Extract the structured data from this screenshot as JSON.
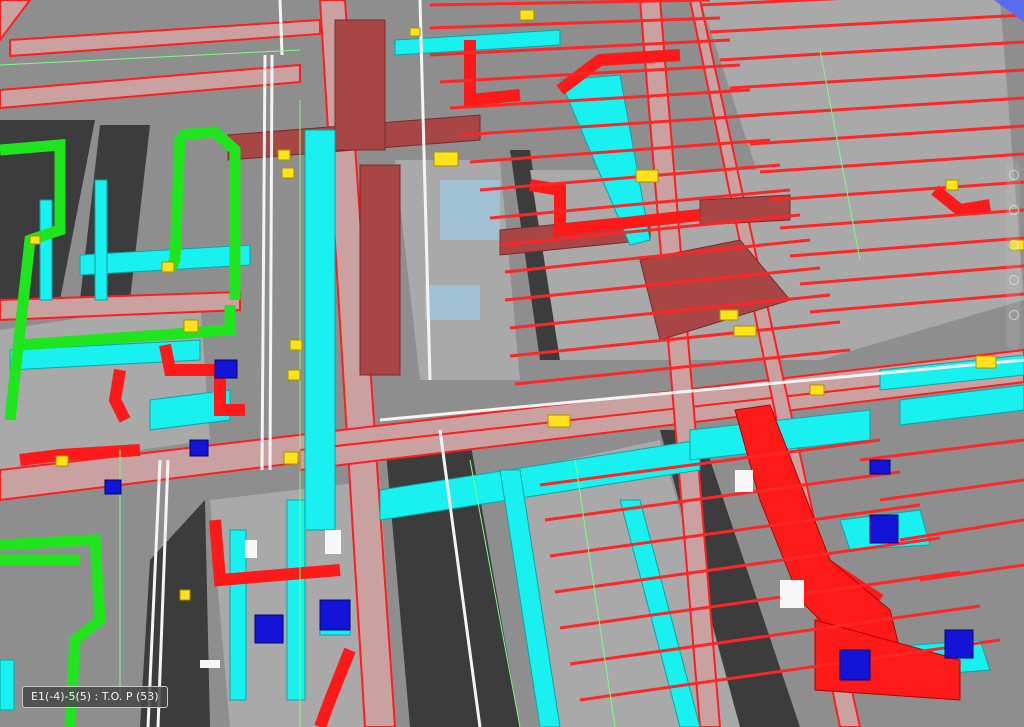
{
  "viewport": {
    "level_label": "E1(-4)-5(5) : T.O. P (53)"
  },
  "colors": {
    "background": "#5a5a5a",
    "slab": "#9a9a9a",
    "slab_shadow": "#3b3b3b",
    "beam_fill": "#c9a3a3",
    "beam_edge": "#ff1e1e",
    "hot_pipe": "#ff1a1a",
    "cold_duct": "#19f0f0",
    "green_pipe": "#1ee51e",
    "fitting_yellow": "#ffe21a",
    "blue_box": "#1414d8",
    "dark_red_duct": "#a84545",
    "white_pipe": "#f4f4f4",
    "sky": "#5b6cf0"
  },
  "icons": {
    "view_cube": "view-navigation-icon"
  }
}
